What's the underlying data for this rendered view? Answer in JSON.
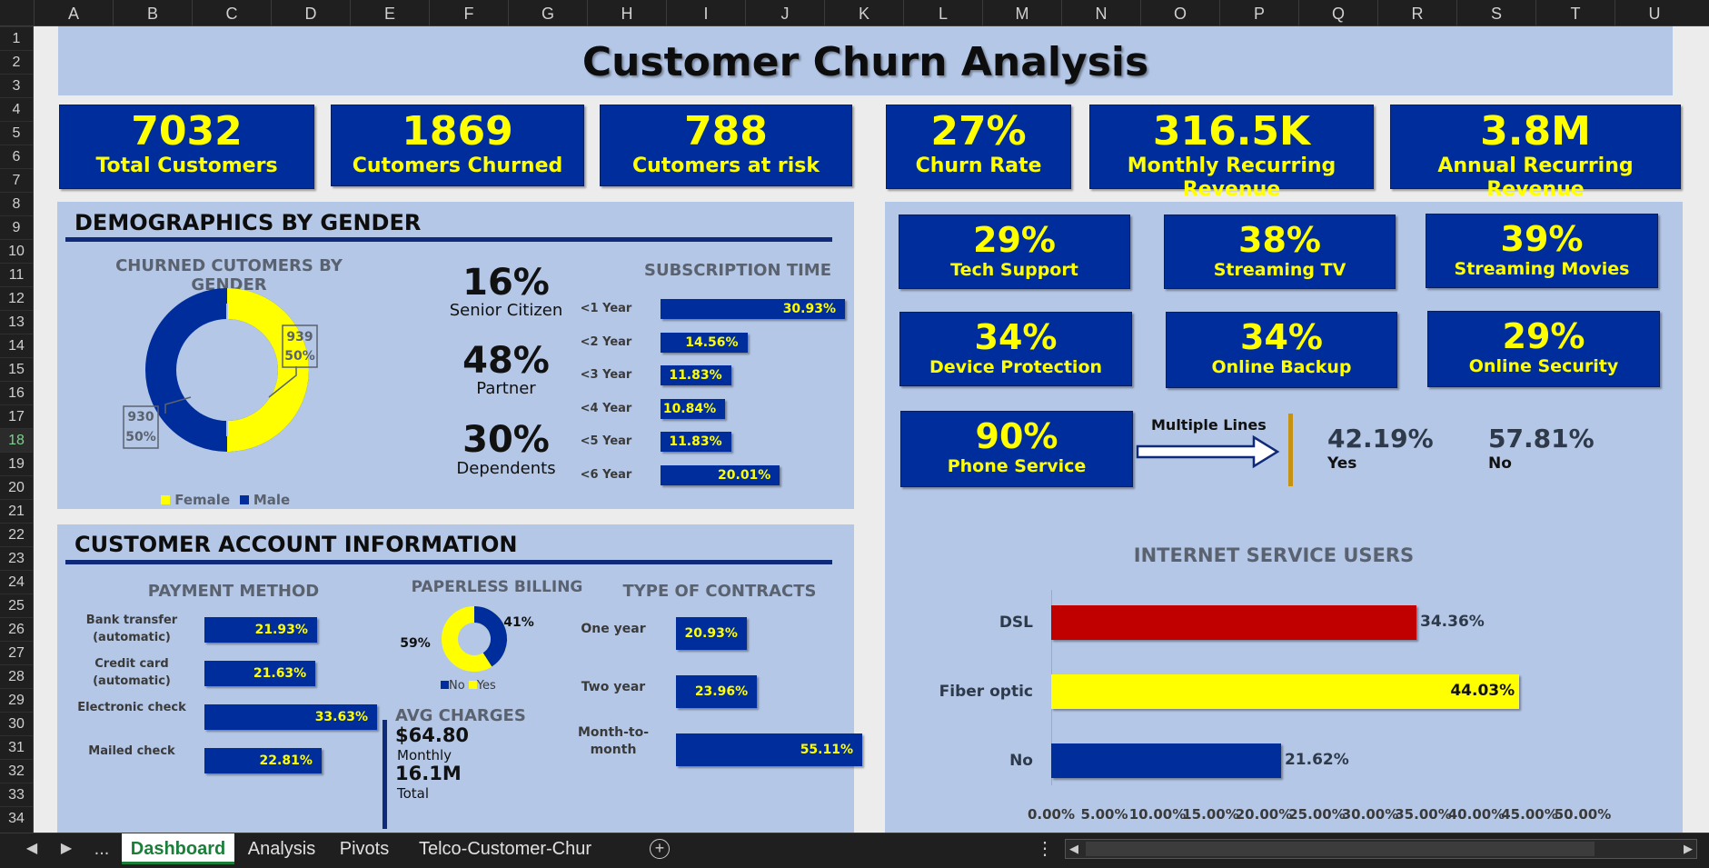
{
  "columns": [
    "A",
    "B",
    "C",
    "D",
    "E",
    "F",
    "G",
    "H",
    "I",
    "J",
    "K",
    "L",
    "M",
    "N",
    "O",
    "P",
    "Q",
    "R",
    "S",
    "T",
    "U"
  ],
  "rows": [
    "1",
    "2",
    "3",
    "4",
    "5",
    "6",
    "7",
    "8",
    "9",
    "10",
    "11",
    "12",
    "13",
    "14",
    "15",
    "16",
    "17",
    "18",
    "19",
    "20",
    "21",
    "22",
    "23",
    "24",
    "25",
    "26",
    "27",
    "28",
    "29",
    "30",
    "31",
    "32",
    "33",
    "34"
  ],
  "selected_row": "18",
  "title": "Customer Churn Analysis",
  "kpis": [
    {
      "value": "7032",
      "label": "Total Customers"
    },
    {
      "value": "1869",
      "label": "Cutomers Churned"
    },
    {
      "value": "788",
      "label": "Cutomers at risk"
    },
    {
      "value": "27%",
      "label": "Churn Rate"
    },
    {
      "value": "316.5K",
      "label": "Monthly Recurring Revenue"
    },
    {
      "value": "3.8M",
      "label": "Annual Recurring Revenue"
    }
  ],
  "demographics": {
    "title": "DEMOGRAPHICS BY GENDER",
    "donut_title": "CHURNED CUTOMERS BY GENDER",
    "female_label": "939\n50%",
    "female_count": "939",
    "female_pct": "50%",
    "male_count": "930",
    "male_pct": "50%",
    "legend": {
      "female": "Female",
      "male": "Male"
    },
    "stats": [
      {
        "value": "16%",
        "label": "Senior Citizen"
      },
      {
        "value": "48%",
        "label": "Partner"
      },
      {
        "value": "30%",
        "label": "Dependents"
      }
    ],
    "subscription_title": "SUBSCRIPTION TIME"
  },
  "services": [
    {
      "value": "29%",
      "label": "Tech Support"
    },
    {
      "value": "38%",
      "label": "Streaming TV"
    },
    {
      "value": "39%",
      "label": "Streaming Movies"
    },
    {
      "value": "34%",
      "label": "Device Protection"
    },
    {
      "value": "34%",
      "label": "Online Backup"
    },
    {
      "value": "29%",
      "label": "Online Security"
    },
    {
      "value": "90%",
      "label": "Phone Service"
    }
  ],
  "multiple_lines": {
    "label": "Multiple Lines",
    "yes_value": "42.19%",
    "yes_label": "Yes",
    "no_value": "57.81%",
    "no_label": "No"
  },
  "account": {
    "title": "CUSTOMER ACCOUNT INFORMATION",
    "payment_title": "PAYMENT METHOD",
    "paperless_title": "PAPERLESS BILLING",
    "paperless_no": "41%",
    "paperless_yes": "59%",
    "paperless_legend": {
      "no": "No",
      "yes": "Yes"
    },
    "contracts_title": "TYPE OF CONTRACTS",
    "avg_title": "AVG CHARGES",
    "avg_monthly": "$64.80",
    "avg_monthly_label": "Monthly",
    "avg_total": "16.1M",
    "avg_total_label": "Total"
  },
  "colors": {
    "band": "#b4c7e7",
    "kpi": "#002d9c",
    "accent": "#ffff00",
    "dsl": "#c00000",
    "fiber": "#ffff00",
    "no": "#002d9c"
  },
  "chart_data": [
    {
      "type": "pie",
      "title": "CHURNED CUTOMERS BY GENDER",
      "categories": [
        "Female",
        "Male"
      ],
      "values": [
        939,
        930
      ],
      "labels": [
        "50%",
        "50%"
      ],
      "legend": "bottom"
    },
    {
      "type": "bar",
      "title": "SUBSCRIPTION TIME",
      "categories": [
        "<1 Year",
        "<2 Year",
        "<3 Year",
        "<4 Year",
        "<5 Year",
        "<6 Year"
      ],
      "values": [
        30.93,
        14.56,
        11.83,
        10.84,
        11.83,
        20.01
      ],
      "labels": [
        "30.93%",
        "14.56%",
        "11.83%",
        "10.84%",
        "11.83%",
        "20.01%"
      ]
    },
    {
      "type": "bar",
      "title": "PAYMENT METHOD",
      "categories": [
        "Bank transfer (automatic)",
        "Credit card (automatic)",
        "Electronic check",
        "Mailed check"
      ],
      "values": [
        21.93,
        21.63,
        33.63,
        22.81
      ],
      "labels": [
        "21.93%",
        "21.63%",
        "33.63%",
        "22.81%"
      ]
    },
    {
      "type": "pie",
      "title": "PAPERLESS BILLING",
      "categories": [
        "No",
        "Yes"
      ],
      "values": [
        41,
        59
      ],
      "labels": [
        "41%",
        "59%"
      ],
      "legend": "bottom"
    },
    {
      "type": "bar",
      "title": "TYPE OF CONTRACTS",
      "categories": [
        "One year",
        "Two year",
        "Month-to-month"
      ],
      "values": [
        20.93,
        23.96,
        55.11
      ],
      "labels": [
        "20.93%",
        "23.96%",
        "55.11%"
      ]
    },
    {
      "type": "bar",
      "title": "INTERNET SERVICE USERS",
      "categories": [
        "DSL",
        "Fiber optic",
        "No"
      ],
      "values": [
        34.36,
        44.03,
        21.62
      ],
      "labels": [
        "34.36%",
        "44.03%",
        "21.62%"
      ],
      "xlim": [
        0,
        50
      ],
      "xticks": [
        "0.00%",
        "5.00%",
        "10.00%",
        "15.00%",
        "20.00%",
        "25.00%",
        "30.00%",
        "35.00%",
        "40.00%",
        "45.00%",
        "50.00%"
      ]
    }
  ],
  "sheet_tabs": [
    "Dashboard",
    "Analysis",
    "Pivots",
    "Telco-Customer-Chur"
  ],
  "nav": {
    "prev": "◀",
    "next": "▶",
    "more": "...",
    "add": "+",
    "menu": "⋮"
  }
}
